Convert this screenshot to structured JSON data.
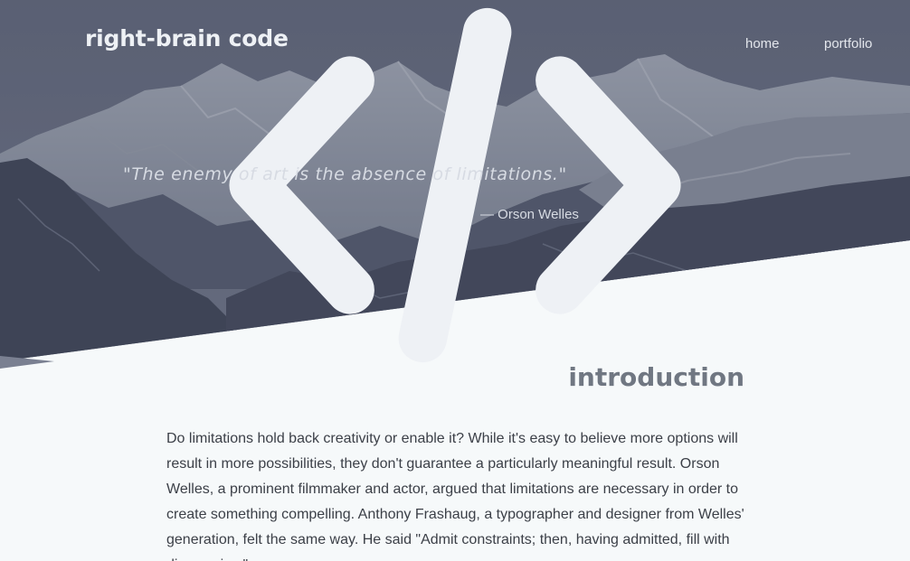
{
  "header": {
    "logo_icon": "code-brackets-icon",
    "brand": "right-brain code",
    "nav": {
      "home": "home",
      "portfolio": "portfolio"
    }
  },
  "hero": {
    "quote": "\"The enemy of art is the absence of limitations.\"",
    "attribution": "— Orson Welles"
  },
  "main": {
    "section_title": "introduction",
    "paragraph": "Do limitations hold back creativity or enable it? While it's easy to believe more options will result in more possibilities, they don't guarantee a particularly meaningful result. Orson Welles, a prominent filmmaker and actor, argued that limitations are necessary in order to create something compelling. Anthony Frashaug, a typographer and designer from Welles' generation, felt the same way. He said \"Admit constraints; then, having admitted, fill with discoveries.\""
  },
  "colors": {
    "hero_overlay": "#4a5062",
    "page_background": "#f6f9fa",
    "heading": "#707782",
    "body_text": "#3c4048"
  }
}
